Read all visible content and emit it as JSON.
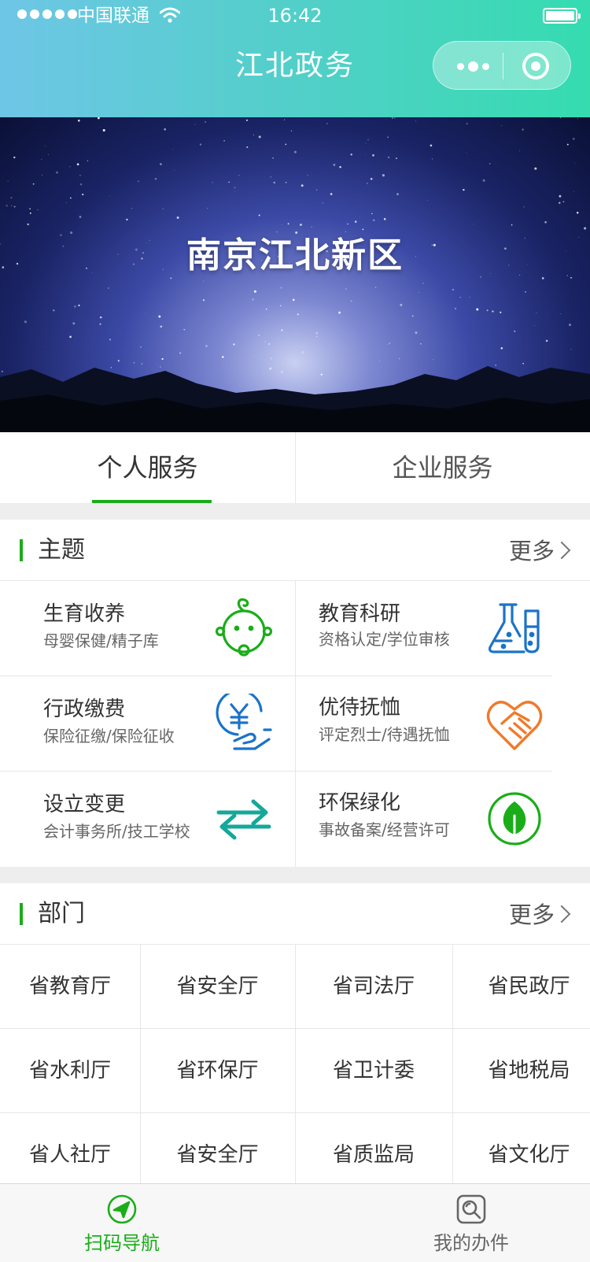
{
  "status_bar": {
    "carrier": "中国联通",
    "time": "16:42"
  },
  "nav": {
    "title": "江北政务"
  },
  "banner": {
    "title": "南京江北新区"
  },
  "tabs": [
    {
      "label": "个人服务",
      "active": true
    },
    {
      "label": "企业服务",
      "active": false
    }
  ],
  "themes_section": {
    "title": "主题",
    "more": "更多",
    "items": [
      {
        "name": "生育收养",
        "sub": "母婴保健/精子库",
        "icon": "baby-face-icon",
        "color": "#1aad19"
      },
      {
        "name": "教育科研",
        "sub": "资格认定/学位审核",
        "icon": "flask-icon",
        "color": "#1a73c8"
      },
      {
        "name": "行政缴费",
        "sub": "保险征缴/保险征收",
        "icon": "yen-hand-icon",
        "color": "#1a73c8"
      },
      {
        "name": "优待抚恤",
        "sub": "评定烈士/待遇抚恤",
        "icon": "heart-hand-icon",
        "color": "#f07a2a"
      },
      {
        "name": "设立变更",
        "sub": "会计事务所/技工学校",
        "icon": "exchange-arrows-icon",
        "color": "#15a89a"
      },
      {
        "name": "环保绿化",
        "sub": "事故备案/经营许可",
        "icon": "leaf-icon",
        "color": "#1aad19"
      }
    ]
  },
  "departments_section": {
    "title": "部门",
    "more": "更多",
    "items": [
      "省教育厅",
      "省安全厅",
      "省司法厅",
      "省民政厅",
      "省水利厅",
      "省环保厅",
      "省卫计委",
      "省地税局",
      "省人社厅",
      "省安全厅",
      "省质监局",
      "省文化厅"
    ]
  },
  "tabbar": {
    "items": [
      {
        "label": "扫码导航",
        "icon": "navigation-arrow-icon",
        "active": true,
        "color": "#1aad19"
      },
      {
        "label": "我的办件",
        "icon": "magnifier-doc-icon",
        "active": false,
        "color": "#666666"
      }
    ]
  }
}
